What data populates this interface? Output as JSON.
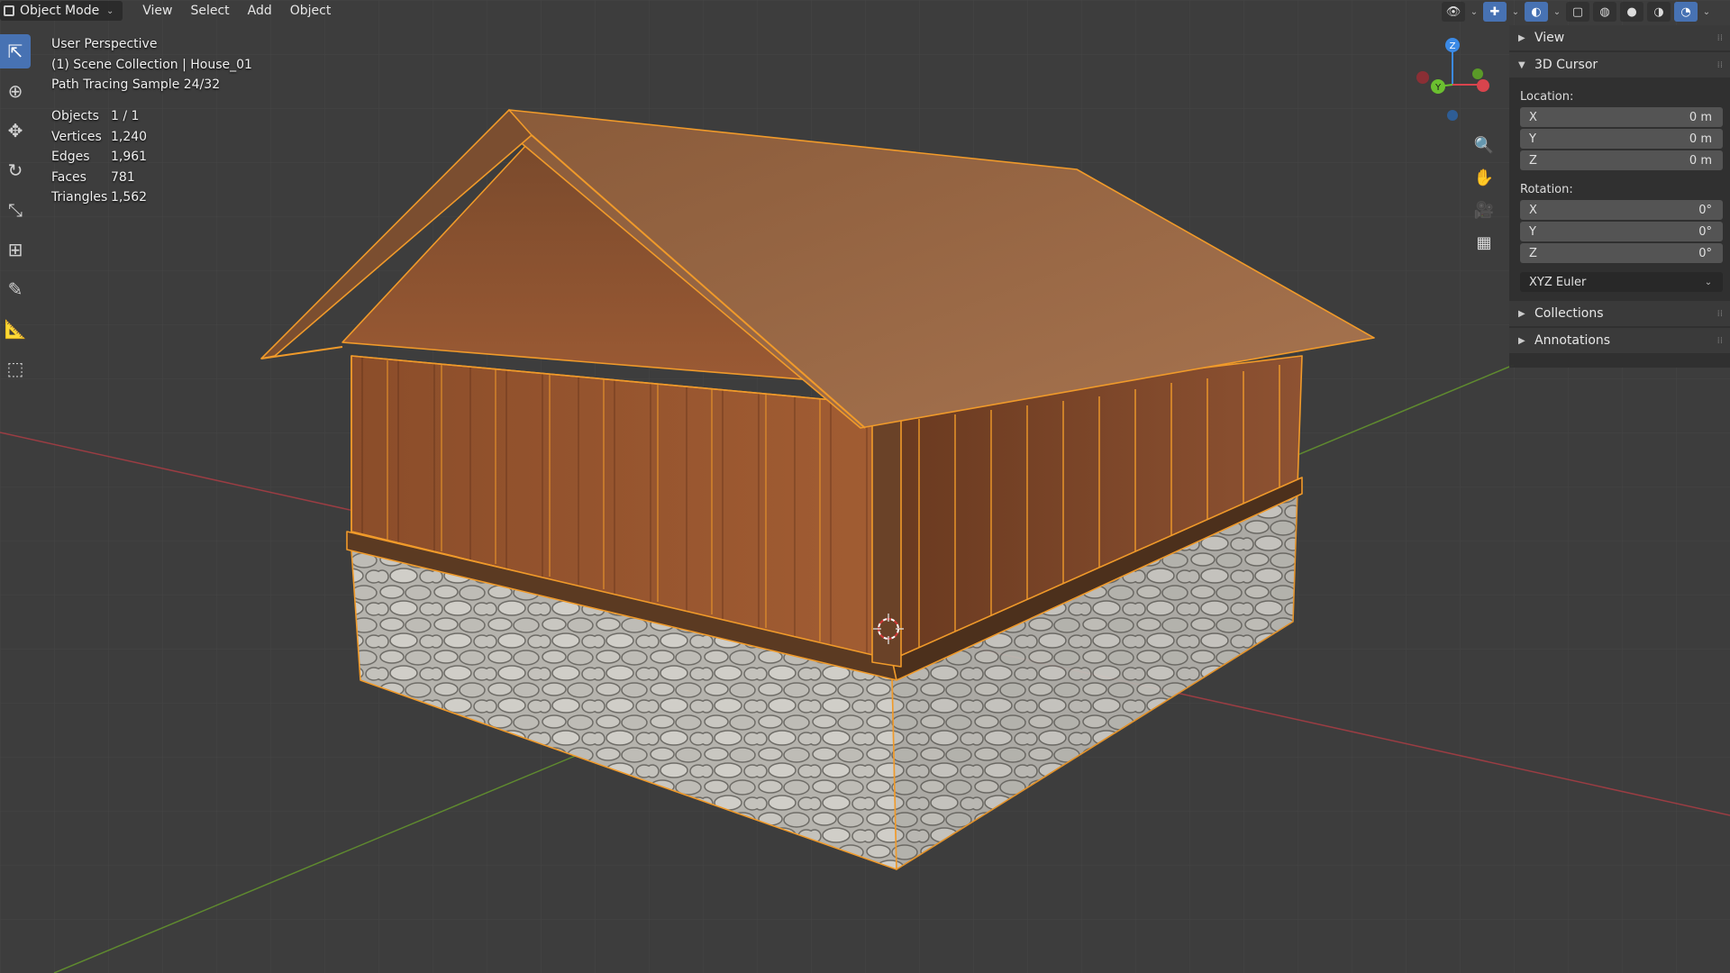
{
  "header": {
    "mode": "Object Mode",
    "menu": [
      "View",
      "Select",
      "Add",
      "Object"
    ]
  },
  "overlay": {
    "perspective": "User Perspective",
    "collection": "(1) Scene Collection | House_01",
    "render_status": "Path Tracing Sample 24/32"
  },
  "stats": [
    {
      "label": "Objects",
      "value": "1 / 1"
    },
    {
      "label": "Vertices",
      "value": "1,240"
    },
    {
      "label": "Edges",
      "value": "1,961"
    },
    {
      "label": "Faces",
      "value": "781"
    },
    {
      "label": "Triangles",
      "value": "1,562"
    }
  ],
  "gizmo": {
    "x": "X",
    "y": "Y",
    "z": "Z"
  },
  "sidebar": {
    "view_label": "View",
    "cursor_label": "3D Cursor",
    "location_label": "Location:",
    "location": [
      {
        "axis": "X",
        "value": "0 m"
      },
      {
        "axis": "Y",
        "value": "0 m"
      },
      {
        "axis": "Z",
        "value": "0 m"
      }
    ],
    "rotation_label": "Rotation:",
    "rotation": [
      {
        "axis": "X",
        "value": "0°"
      },
      {
        "axis": "Y",
        "value": "0°"
      },
      {
        "axis": "Z",
        "value": "0°"
      }
    ],
    "rotation_mode": "XYZ Euler",
    "collections_label": "Collections",
    "annotations_label": "Annotations"
  },
  "colors": {
    "accent": "#4772b3",
    "selection_outline": "#f09a2a",
    "axis_x": "#d8444d",
    "axis_y": "#6bbf30",
    "axis_z": "#3b8ae6"
  }
}
